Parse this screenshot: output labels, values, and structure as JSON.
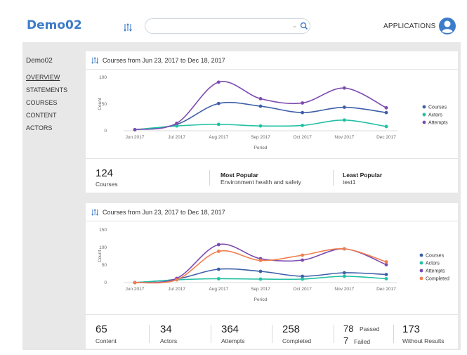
{
  "header": {
    "brand": "Demo02",
    "search_value": "",
    "applications_label": "APPLICATIONS"
  },
  "sidebar": {
    "title": "Demo02",
    "items": [
      {
        "label": "OVERVIEW",
        "active": true
      },
      {
        "label": "STATEMENTS",
        "active": false
      },
      {
        "label": "COURSES",
        "active": false
      },
      {
        "label": "CONTENT",
        "active": false
      },
      {
        "label": "ACTORS",
        "active": false
      }
    ]
  },
  "colors": {
    "brand": "#3d7cc9",
    "courses": "#3d5fa8",
    "actors": "#21c0a3",
    "attempts": "#7c4bb0",
    "completed": "#f07f4e"
  },
  "card1": {
    "title": "Courses from Jun 23, 2017 to Dec 18, 2017",
    "stats": {
      "count": "124",
      "count_label": "Courses",
      "most_popular_title": "Most Popular",
      "most_popular_value": "Environment health and safety",
      "least_popular_title": "Least Popular",
      "least_popular_value": "test1"
    }
  },
  "card2": {
    "title": "Courses from Jun 23, 2017 to Dec 18, 2017",
    "stats": [
      {
        "value": "65",
        "label": "Content"
      },
      {
        "value": "34",
        "label": "Actors"
      },
      {
        "value": "364",
        "label": "Attempts"
      },
      {
        "value": "258",
        "label": "Completed"
      },
      {
        "passed_value": "78",
        "passed_label": "Passed",
        "failed_value": "7",
        "failed_label": "Failed"
      },
      {
        "value": "173",
        "label": "Without Results"
      }
    ]
  },
  "chart_data": [
    {
      "type": "line",
      "x": [
        "Jun 2017",
        "Jul 2017",
        "Aug 2017",
        "Sep 2017",
        "Oct 2017",
        "Nov 2017",
        "Dec 2017"
      ],
      "xlabel": "Period",
      "ylabel": "Count",
      "ylim": [
        0,
        100
      ],
      "yticks": [
        0,
        50,
        100
      ],
      "legend": "right",
      "series": [
        {
          "name": "Courses",
          "color": "#3d5fa8",
          "values": [
            2,
            12,
            51,
            46,
            34,
            44,
            34
          ]
        },
        {
          "name": "Actors",
          "color": "#21c0a3",
          "values": [
            2,
            9,
            12,
            9,
            10,
            20,
            8
          ]
        },
        {
          "name": "Attempts",
          "color": "#7c4bb0",
          "values": [
            2,
            14,
            91,
            60,
            52,
            80,
            43
          ]
        }
      ]
    },
    {
      "type": "line",
      "x": [
        "Jun 2017",
        "Jul 2017",
        "Aug 2017",
        "Sep 2017",
        "Oct 2017",
        "Nov 2017",
        "Dec 2017"
      ],
      "xlabel": "Period",
      "ylabel": "Count",
      "ylim": [
        0,
        150
      ],
      "yticks": [
        0,
        50,
        100,
        150
      ],
      "legend": "right",
      "series": [
        {
          "name": "Courses",
          "color": "#3d5fa8",
          "values": [
            0,
            10,
            38,
            32,
            18,
            28,
            23
          ]
        },
        {
          "name": "Actors",
          "color": "#21c0a3",
          "values": [
            0,
            8,
            11,
            10,
            10,
            18,
            11
          ]
        },
        {
          "name": "Attempts",
          "color": "#7c4bb0",
          "values": [
            0,
            12,
            108,
            68,
            64,
            96,
            51
          ]
        },
        {
          "name": "Completed",
          "color": "#f07f4e",
          "values": [
            0,
            8,
            89,
            63,
            78,
            96,
            59
          ]
        }
      ]
    }
  ]
}
